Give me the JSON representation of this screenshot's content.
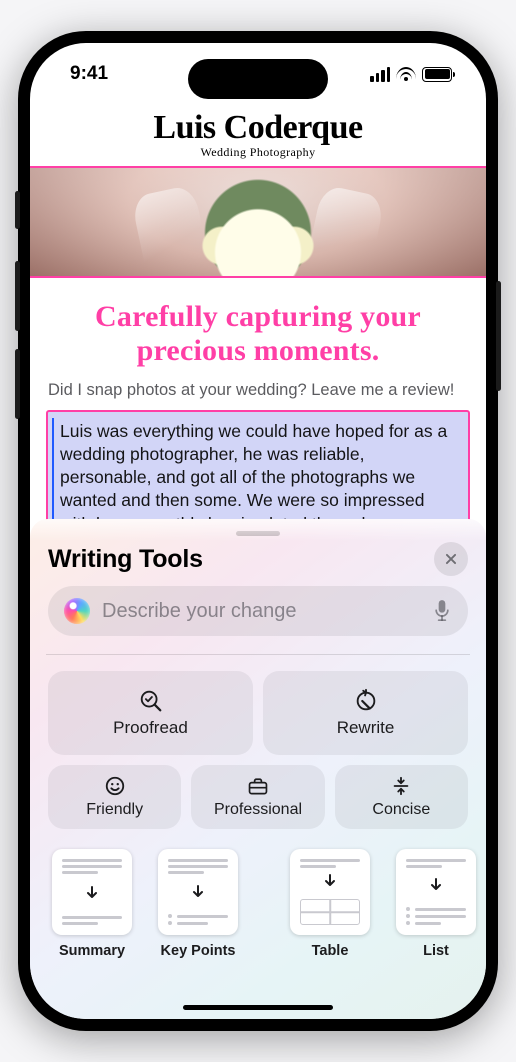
{
  "status": {
    "time": "9:41"
  },
  "header": {
    "name": "Luis Coderque",
    "subtitle": "Wedding Photography"
  },
  "tagline": "Carefully capturing your precious moments.",
  "prompt": "Did I snap photos at your wedding? Leave me a review!",
  "review": "Luis was everything we could have hoped for as a wedding photographer, he was reliable, personable, and got all of the photographs we wanted and then some. We were so impressed with how smoothly he circulated through our ceremony and reception. We barely realized he was there except when he was very",
  "sheet": {
    "title": "Writing Tools",
    "placeholder": "Describe your change",
    "close_label": "Close",
    "tiles": {
      "proofread": "Proofread",
      "rewrite": "Rewrite",
      "friendly": "Friendly",
      "professional": "Professional",
      "concise": "Concise"
    },
    "formats": {
      "summary": "Summary",
      "key_points": "Key Points",
      "table": "Table",
      "list": "List"
    }
  }
}
